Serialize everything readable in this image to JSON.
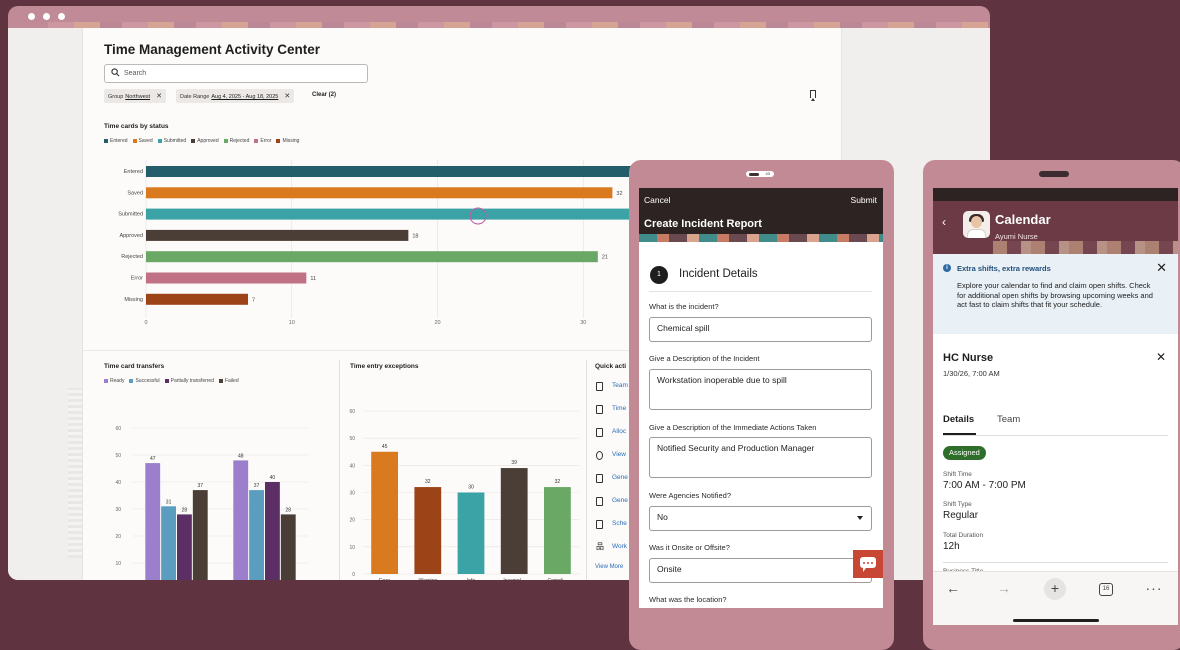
{
  "desktop": {
    "title": "Time Management Activity Center",
    "search_placeholder": "Search",
    "filters": [
      {
        "label": "Group",
        "value": "Northwest"
      },
      {
        "label": "Date Range",
        "value": "Aug 4, 2025 - Aug 18, 2025"
      }
    ],
    "clear_label": "Clear (2)",
    "status_section_title": "Time cards by status",
    "transfers_title": "Time card transfers",
    "exceptions_title": "Time entry exceptions",
    "quick_actions_title": "Quick acti",
    "quick_actions": [
      "Team",
      "Time",
      "Alloc",
      "View",
      "Gene",
      "Gene",
      "Sche",
      "Work"
    ],
    "view_more": "View More",
    "colors": {
      "teal_dark": "#235e6a",
      "orange": "#d97a1e",
      "teal": "#3ba3a6",
      "brown_dark": "#4b3e36",
      "green": "#6aa865",
      "pink": "#c07284",
      "rust": "#9c4318",
      "purple_light": "#9b7fcc",
      "blue": "#5b9dbf",
      "purple_dark": "#5b2e66"
    }
  },
  "chart_data": [
    {
      "type": "bar",
      "orientation": "horizontal",
      "title": "Time cards by status",
      "legend": [
        "Entered",
        "Saved",
        "Submitted",
        "Approved",
        "Rejected",
        "Error",
        "Missing"
      ],
      "legend_position": "top-left",
      "categories": [
        "Entered",
        "Saved",
        "Submitted",
        "Approved",
        "Rejected",
        "Error",
        "Missing"
      ],
      "values": [
        44,
        32,
        40,
        18,
        31,
        11,
        7
      ],
      "value_labels": [
        "",
        "32",
        "",
        "18",
        "21",
        "11",
        "7"
      ],
      "xticks": [
        0,
        10,
        20,
        30
      ],
      "xlim": [
        0,
        40
      ],
      "grid": true
    },
    {
      "type": "bar",
      "title": "Time card transfers",
      "categories": [
        "Payroll",
        "Projects"
      ],
      "series": [
        {
          "name": "Ready",
          "values": [
            47,
            48
          ]
        },
        {
          "name": "Successful",
          "values": [
            31,
            37
          ]
        },
        {
          "name": "Partially transferred",
          "values": [
            28,
            40
          ]
        },
        {
          "name": "Failed",
          "values": [
            37,
            28
          ]
        }
      ],
      "yticks": [
        0,
        10,
        20,
        30,
        40,
        50,
        60
      ],
      "ylim": [
        0,
        60
      ],
      "legend_position": "top-left",
      "grid": true
    },
    {
      "type": "bar",
      "title": "Time entry exceptions",
      "categories": [
        "Error",
        "Warning",
        "Info",
        "Incompl...",
        "Compli..."
      ],
      "values": [
        45,
        32,
        30,
        39,
        32
      ],
      "yticks": [
        0,
        10,
        20,
        30,
        40,
        50,
        60
      ],
      "ylim": [
        0,
        60
      ],
      "grid": true
    }
  ],
  "tablet": {
    "status_badge": "43",
    "cancel": "Cancel",
    "submit": "Submit",
    "title": "Create Incident Report",
    "step_number": "1",
    "section_title": "Incident Details",
    "fields": [
      {
        "label": "What is the incident?",
        "value": "Chemical spill"
      },
      {
        "label": "Give a Description of the Incident",
        "value": "Workstation inoperable due to spill"
      },
      {
        "label": "Give a Description of the Immediate Actions Taken",
        "value": "Notified Security and Production Manager"
      },
      {
        "label": "Were Agencies Notified?",
        "value": "No"
      },
      {
        "label": "Was it Onsite or Offsite?",
        "value": "Onsite"
      },
      {
        "label": "What was the location?",
        "value": ""
      }
    ]
  },
  "phone": {
    "title": "Calendar",
    "subtitle": "Ayumi Nurse",
    "banner_title": "Extra shifts, extra rewards",
    "banner_text": "Explore your calendar to find and claim open shifts. Check for additional open shifts by browsing upcoming weeks and act fast to claim shifts that fit your schedule.",
    "card_title": "HC Nurse",
    "card_subtitle": "1/30/26, 7:00 AM",
    "tabs": [
      "Details",
      "Team"
    ],
    "status": "Assigned",
    "details": [
      {
        "label": "Shift Time",
        "value": "7:00 AM - 7:00 PM"
      },
      {
        "label": "Shift Type",
        "value": "Regular"
      },
      {
        "label": "Total Duration",
        "value": "12h"
      }
    ],
    "cut_label": "Business Title",
    "tab_count": "16"
  }
}
